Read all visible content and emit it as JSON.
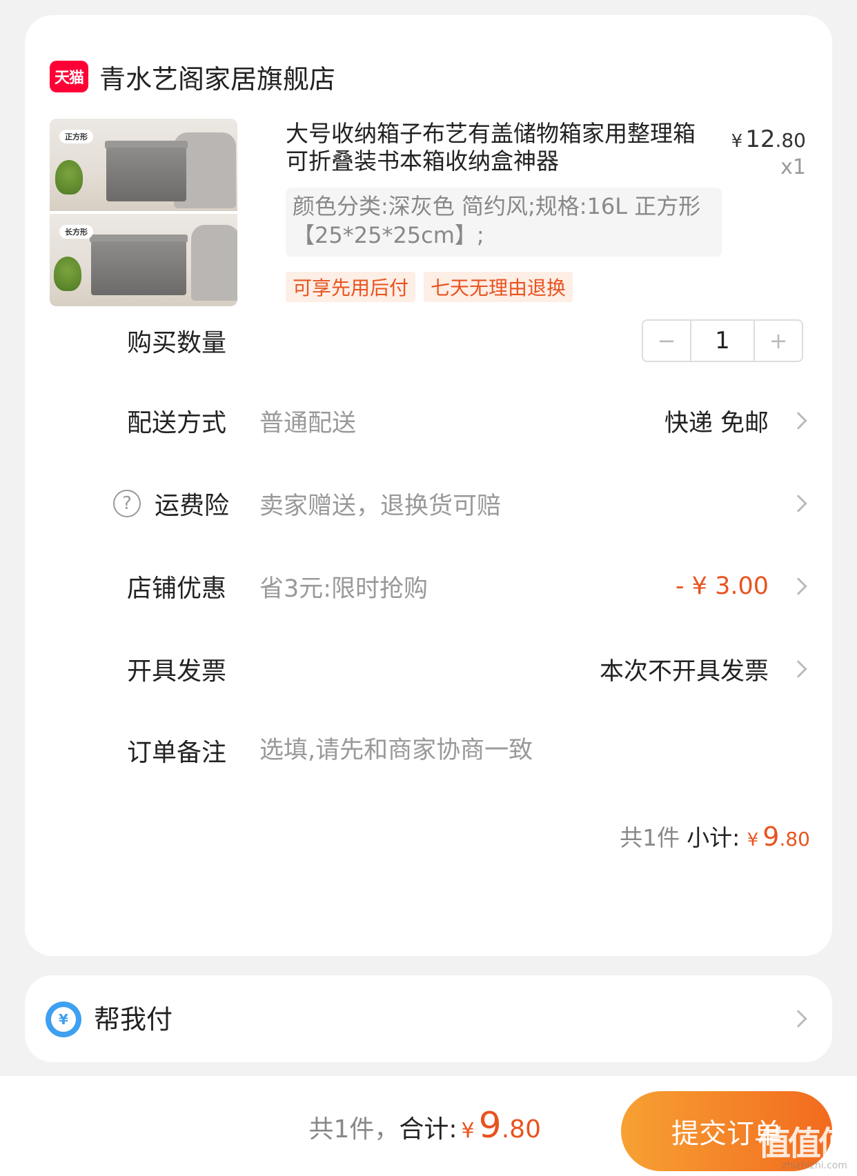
{
  "store": {
    "logo_text": "天猫",
    "name": "青水艺阁家居旗舰店"
  },
  "product": {
    "image_tags": [
      "正方形",
      "长方形"
    ],
    "title": "大号收纳箱子布艺有盖储物箱家用整理箱可折叠装书本箱收纳盒神器",
    "price_symbol": "¥",
    "price_int": "12",
    "price_cents": ".80",
    "quantity_label": "x1",
    "sku": "颜色分类:深灰色 简约风;规格:16L 正方形【25*25*25cm】;",
    "tags": [
      "可享先用后付",
      "七天无理由退换"
    ]
  },
  "rows": {
    "quantity": {
      "label": "购买数量",
      "value": "1",
      "minus": "−",
      "plus": "+"
    },
    "delivery": {
      "label": "配送方式",
      "sub": "普通配送",
      "value": "快递 免邮"
    },
    "insurance": {
      "icon_text": "?",
      "label": "运费险",
      "sub": "卖家赠送，退换货可赔"
    },
    "discount": {
      "label": "店铺优惠",
      "sub": "省3元:限时抢购",
      "value": "- ¥ 3.00"
    },
    "invoice": {
      "label": "开具发票",
      "value": "本次不开具发票"
    },
    "note": {
      "label": "订单备注",
      "placeholder": "选填,请先和商家协商一致"
    }
  },
  "subtotal": {
    "count": "共1件",
    "label": "小计:",
    "symbol": "¥",
    "int": "9",
    "cents": ".80"
  },
  "pay_for_me": {
    "icon_text": "¥",
    "label": "帮我付"
  },
  "footer": {
    "count": "共1件，",
    "label": "合计:",
    "symbol": "¥",
    "int": "9",
    "cents": ".80",
    "submit_label": "提交订单"
  },
  "watermark": {
    "text": "值值值",
    "url": "zhizhizhi.com"
  },
  "colors": {
    "accent": "#e8531f",
    "tmall_red": "#ff0036",
    "pay_blue": "#3ea0f0"
  }
}
